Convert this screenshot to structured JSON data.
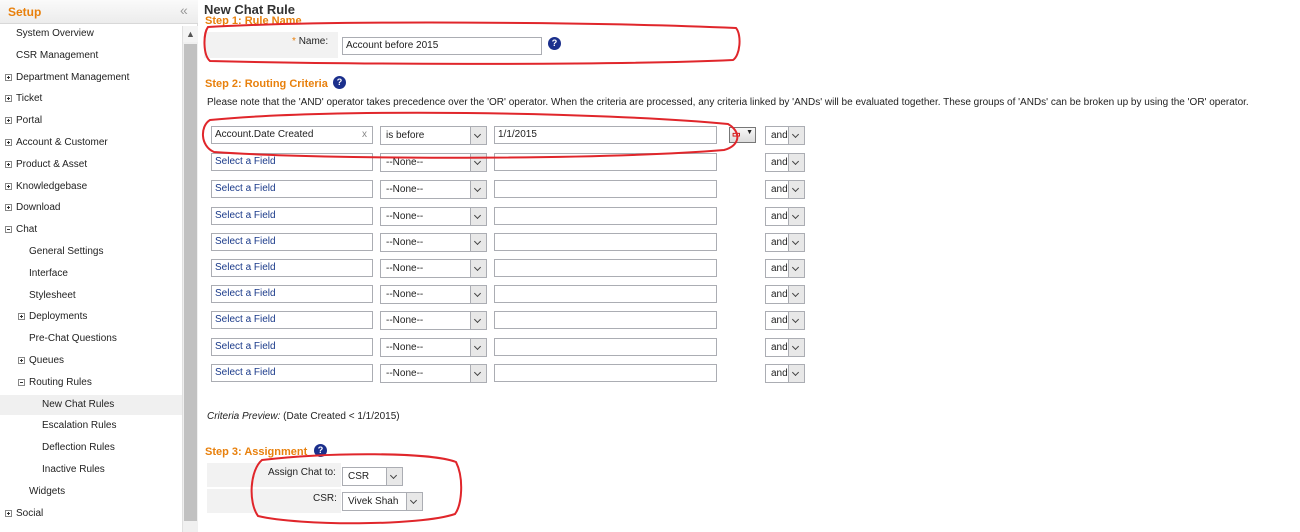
{
  "sidebar": {
    "title": "Setup",
    "collapse_icon": "double-chevron-left-icon",
    "items": [
      {
        "label": "System Overview",
        "level": 0,
        "expander": "none"
      },
      {
        "label": "CSR Management",
        "level": 0,
        "expander": "none"
      },
      {
        "label": "Department Management",
        "level": 0,
        "expander": "plus"
      },
      {
        "label": "Ticket",
        "level": 0,
        "expander": "plus"
      },
      {
        "label": "Portal",
        "level": 0,
        "expander": "plus"
      },
      {
        "label": "Account & Customer",
        "level": 0,
        "expander": "plus"
      },
      {
        "label": "Product & Asset",
        "level": 0,
        "expander": "plus"
      },
      {
        "label": "Knowledgebase",
        "level": 0,
        "expander": "plus"
      },
      {
        "label": "Download",
        "level": 0,
        "expander": "plus"
      },
      {
        "label": "Chat",
        "level": 0,
        "expander": "minus"
      },
      {
        "label": "General Settings",
        "level": 1,
        "expander": "none"
      },
      {
        "label": "Interface",
        "level": 1,
        "expander": "none"
      },
      {
        "label": "Stylesheet",
        "level": 1,
        "expander": "none"
      },
      {
        "label": "Deployments",
        "level": 1,
        "expander": "plus"
      },
      {
        "label": "Pre-Chat Questions",
        "level": 1,
        "expander": "none"
      },
      {
        "label": "Queues",
        "level": 1,
        "expander": "plus"
      },
      {
        "label": "Routing Rules",
        "level": 1,
        "expander": "minus"
      },
      {
        "label": "New Chat Rules",
        "level": 2,
        "expander": "none",
        "selected": true
      },
      {
        "label": "Escalation Rules",
        "level": 2,
        "expander": "none"
      },
      {
        "label": "Deflection Rules",
        "level": 2,
        "expander": "none"
      },
      {
        "label": "Inactive Rules",
        "level": 2,
        "expander": "none"
      },
      {
        "label": "Widgets",
        "level": 1,
        "expander": "none"
      },
      {
        "label": "Social",
        "level": 0,
        "expander": "plus"
      }
    ]
  },
  "page": {
    "title": "New Chat Rule"
  },
  "step1": {
    "heading": "Step 1: Rule Name",
    "name_label": "Name:",
    "required_marker": "*",
    "name_value": "Account before 2015"
  },
  "step2": {
    "heading": "Step 2: Routing Criteria",
    "note": "Please note that the 'AND' operator takes precedence over the 'OR' operator. When the criteria are processed, any criteria linked by 'ANDs' will be evaluated together. These groups of 'ANDs' can be broken up by using the 'OR' operator.",
    "clear_glyph": "x",
    "rows": [
      {
        "field": "Account.Date Created",
        "operator": "is before",
        "value": "1/1/2015",
        "conjunction": "and",
        "filled": true
      },
      {
        "field": "Select a Field",
        "operator": "--None--",
        "value": "",
        "conjunction": "and",
        "filled": false
      },
      {
        "field": "Select a Field",
        "operator": "--None--",
        "value": "",
        "conjunction": "and",
        "filled": false
      },
      {
        "field": "Select a Field",
        "operator": "--None--",
        "value": "",
        "conjunction": "and",
        "filled": false
      },
      {
        "field": "Select a Field",
        "operator": "--None--",
        "value": "",
        "conjunction": "and",
        "filled": false
      },
      {
        "field": "Select a Field",
        "operator": "--None--",
        "value": "",
        "conjunction": "and",
        "filled": false
      },
      {
        "field": "Select a Field",
        "operator": "--None--",
        "value": "",
        "conjunction": "and",
        "filled": false
      },
      {
        "field": "Select a Field",
        "operator": "--None--",
        "value": "",
        "conjunction": "and",
        "filled": false
      },
      {
        "field": "Select a Field",
        "operator": "--None--",
        "value": "",
        "conjunction": "and",
        "filled": false
      },
      {
        "field": "Select a Field",
        "operator": "--None--",
        "value": "",
        "conjunction": "and",
        "filled": false
      }
    ],
    "row_action_icon": "date-picker-dropdown-icon",
    "preview_label": "Criteria Preview:",
    "preview_value": "(Date Created < 1/1/2015)"
  },
  "step3": {
    "heading": "Step 3: Assignment",
    "assign_label": "Assign Chat to:",
    "assign_value": "CSR",
    "csr_label": "CSR:",
    "csr_value": "Vivek Shah"
  },
  "colors": {
    "accent_orange": "#e8800c",
    "help_icon_blue": "#1b2f8c",
    "annotation_red": "#e0262b",
    "link_blue": "#1a3a8a"
  }
}
